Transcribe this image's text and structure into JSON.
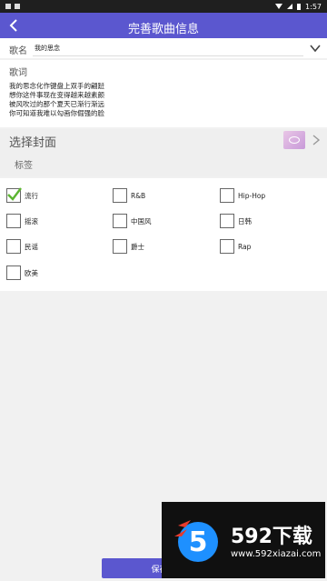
{
  "status_bar": {
    "time": "1:57"
  },
  "app_bar": {
    "title": "完善歌曲信息",
    "back_icon": "back-arrow-icon"
  },
  "song_name": {
    "label": "歌名",
    "value": "我的思念"
  },
  "lyrics": {
    "label": "歌词",
    "text": "我的思念化作键盘上双手的翩跹\n想你这件事现在变得越来越素颜\n被风吹过的那个夏天已渐行渐远\n你可知道我难以勾画你倔强的脸"
  },
  "cover": {
    "label": "选择封面"
  },
  "tags": {
    "header": "标签",
    "items": [
      {
        "label": "流行",
        "checked": true
      },
      {
        "label": "R&B",
        "checked": false
      },
      {
        "label": "Hip-Hop",
        "checked": false
      },
      {
        "label": "摇滚",
        "checked": false
      },
      {
        "label": "中国风",
        "checked": false
      },
      {
        "label": "日韩",
        "checked": false
      },
      {
        "label": "民谣",
        "checked": false
      },
      {
        "label": "爵士",
        "checked": false
      },
      {
        "label": "Rap",
        "checked": false
      },
      {
        "label": "欧美",
        "checked": false
      }
    ]
  },
  "save_button": {
    "label": "保存到"
  },
  "watermark": {
    "brand": "592下载",
    "url": "www.592xiazai.com"
  },
  "colors": {
    "primary": "#5b57cf",
    "check": "#5cb531"
  }
}
